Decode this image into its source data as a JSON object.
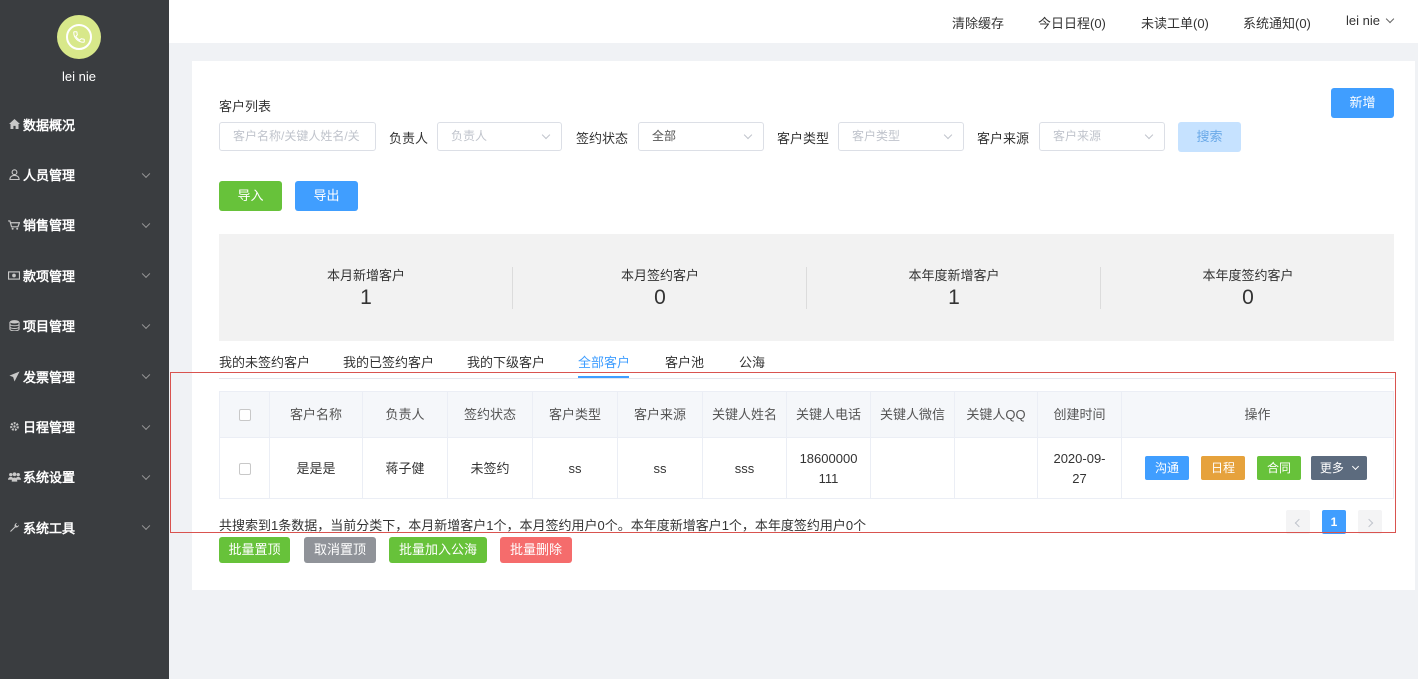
{
  "user": {
    "name": "lei nie"
  },
  "sidebar": {
    "items": [
      {
        "label": "数据概况",
        "icon": "home-icon",
        "expandable": false
      },
      {
        "label": "人员管理",
        "icon": "user-icon",
        "expandable": true
      },
      {
        "label": "销售管理",
        "icon": "cart-icon",
        "expandable": true
      },
      {
        "label": "款项管理",
        "icon": "money-icon",
        "expandable": true
      },
      {
        "label": "项目管理",
        "icon": "database-icon",
        "expandable": true
      },
      {
        "label": "发票管理",
        "icon": "send-icon",
        "expandable": true
      },
      {
        "label": "日程管理",
        "icon": "gear-icon",
        "expandable": true
      },
      {
        "label": "系统设置",
        "icon": "users-icon",
        "expandable": true
      },
      {
        "label": "系统工具",
        "icon": "wrench-icon",
        "expandable": true
      }
    ]
  },
  "topbar": {
    "clear_cache": "清除缓存",
    "today_schedule": "今日日程(0)",
    "unread_tickets": "未读工单(0)",
    "notifications": "系统通知(0)",
    "user": "lei nie"
  },
  "page": {
    "title": "客户列表",
    "new_button": "新增",
    "search_placeholder": "客户名称/关键人姓名/关",
    "owner_label": "负责人",
    "owner_placeholder": "负责人",
    "sign_status_label": "签约状态",
    "sign_status_value": "全部",
    "customer_type_label": "客户类型",
    "customer_type_placeholder": "客户类型",
    "customer_source_label": "客户来源",
    "customer_source_placeholder": "客户来源",
    "search_button": "搜索",
    "import_button": "导入",
    "export_button": "导出"
  },
  "stats": [
    {
      "label": "本月新增客户",
      "value": "1"
    },
    {
      "label": "本月签约客户",
      "value": "0"
    },
    {
      "label": "本年度新增客户",
      "value": "1"
    },
    {
      "label": "本年度签约客户",
      "value": "0"
    }
  ],
  "tabs": {
    "items": [
      "我的未签约客户",
      "我的已签约客户",
      "我的下级客户",
      "全部客户",
      "客户池",
      "公海"
    ],
    "active": "全部客户"
  },
  "table": {
    "headers": [
      "客户名称",
      "负责人",
      "签约状态",
      "客户类型",
      "客户来源",
      "关键人姓名",
      "关键人电话",
      "关键人微信",
      "关键人QQ",
      "创建时间",
      "操作"
    ],
    "rows": [
      {
        "name": "是是是",
        "owner": "蒋子健",
        "status": "未签约",
        "type": "ss",
        "source": "ss",
        "contact_name": "sss",
        "contact_phone_1": "18600000",
        "contact_phone_2": "111",
        "wechat": "",
        "qq": "",
        "created_1": "2020-09-",
        "created_2": "27",
        "actions": {
          "communicate": "沟通",
          "schedule": "日程",
          "contract": "合同",
          "more": "更多"
        }
      }
    ]
  },
  "summary": "共搜索到1条数据，当前分类下，本月新增客户1个，本月签约用户0个。本年度新增客户1个，本年度签约用户0个",
  "pagination": {
    "current": "1"
  },
  "bulk": {
    "pin": "批量置顶",
    "unpin": "取消置顶",
    "to_public": "批量加入公海",
    "delete": "批量删除"
  },
  "colors": {
    "primary": "#409eff",
    "success": "#67c23a",
    "warning": "#e6a23c",
    "info": "#909399",
    "danger": "#f56c6c",
    "sidebar_bg": "#3a3d40",
    "highlight_border": "#d9534f"
  }
}
